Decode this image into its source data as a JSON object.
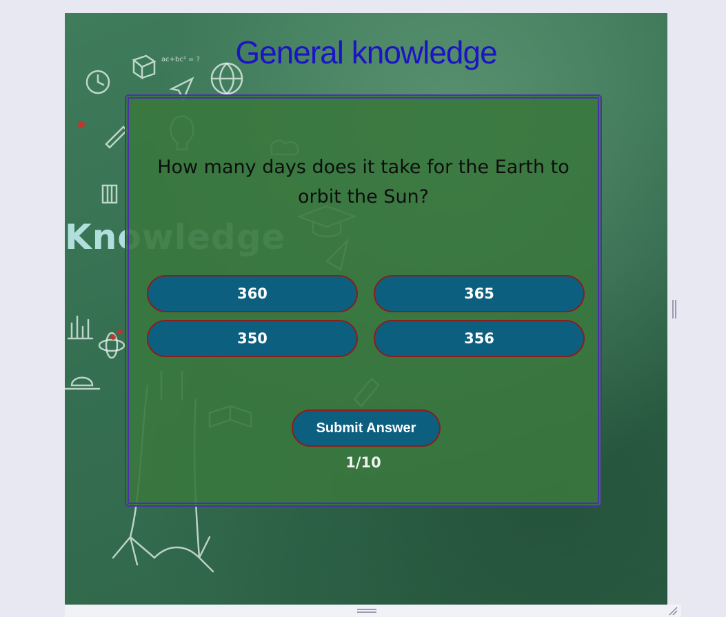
{
  "quiz": {
    "title": "General knowledge",
    "question": "How many days does it take for the Earth to orbit the Sun?",
    "options": [
      "360",
      "365",
      "350",
      "356"
    ],
    "submit_label": "Submit Answer",
    "progress_text": "1/10"
  },
  "background": {
    "doodle_word": "Knowledge",
    "doodle_note": "ac+bc² = ?"
  },
  "colors": {
    "title": "#1c14c4",
    "button_fill": "#0d5f80",
    "button_border": "#8b1d1d",
    "box_border": "#4a2fb0",
    "board": "#3a7c5a"
  },
  "icons": {
    "side_resize": "vertical-split-handle-icon",
    "bottom_resize": "horizontal-split-handle-icon",
    "corner_resize": "resize-grip-icon"
  }
}
